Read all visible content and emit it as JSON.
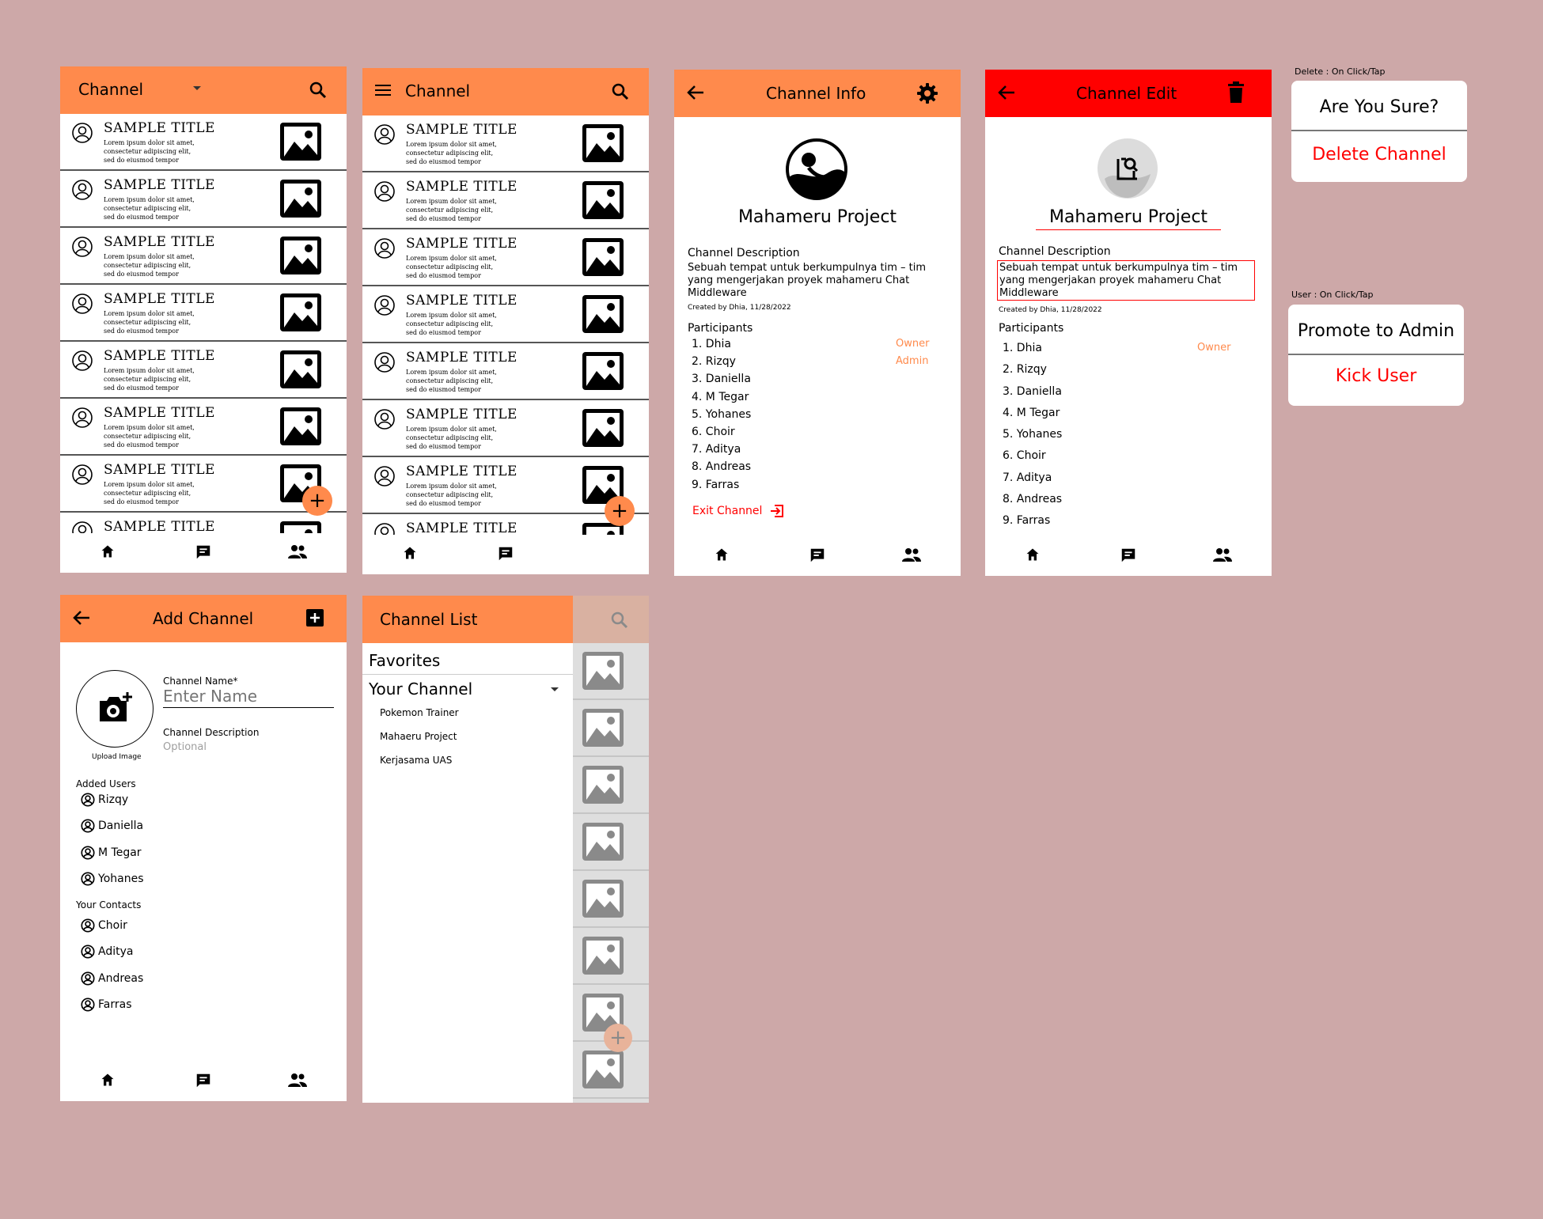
{
  "colors": {
    "accent": "#ff8a4c",
    "danger": "#ff0000",
    "background": "#cda8a8"
  },
  "screen1": {
    "title": "Channel",
    "rows": [
      {
        "title": "SAMPLE TITLE",
        "desc": "Lorem ipsum dolor sit amet, consectetur adipiscing elit, sed do eiusmod tempor"
      },
      {
        "title": "SAMPLE TITLE",
        "desc": "Lorem ipsum dolor sit amet, consectetur adipiscing elit, sed do eiusmod tempor"
      },
      {
        "title": "SAMPLE TITLE",
        "desc": "Lorem ipsum dolor sit amet, consectetur adipiscing elit, sed do eiusmod tempor"
      },
      {
        "title": "SAMPLE TITLE",
        "desc": "Lorem ipsum dolor sit amet, consectetur adipiscing elit, sed do eiusmod tempor"
      },
      {
        "title": "SAMPLE TITLE",
        "desc": "Lorem ipsum dolor sit amet, consectetur adipiscing elit, sed do eiusmod tempor"
      },
      {
        "title": "SAMPLE TITLE",
        "desc": "Lorem ipsum dolor sit amet, consectetur adipiscing elit, sed do eiusmod tempor"
      },
      {
        "title": "SAMPLE TITLE",
        "desc": "Lorem ipsum dolor sit amet, consectetur adipiscing elit, sed do eiusmod tempor"
      },
      {
        "title": "SAMPLE TITLE",
        "desc": ""
      }
    ],
    "fab": "+"
  },
  "screen2": {
    "title": "Channel",
    "rows": [
      {
        "title": "SAMPLE TITLE",
        "desc": "Lorem ipsum dolor sit amet, consectetur adipiscing elit, sed do eiusmod tempor"
      },
      {
        "title": "SAMPLE TITLE",
        "desc": "Lorem ipsum dolor sit amet, consectetur adipiscing elit, sed do eiusmod tempor"
      },
      {
        "title": "SAMPLE TITLE",
        "desc": "Lorem ipsum dolor sit amet, consectetur adipiscing elit, sed do eiusmod tempor"
      },
      {
        "title": "SAMPLE TITLE",
        "desc": "Lorem ipsum dolor sit amet, consectetur adipiscing elit, sed do eiusmod tempor"
      },
      {
        "title": "SAMPLE TITLE",
        "desc": "Lorem ipsum dolor sit amet, consectetur adipiscing elit, sed do eiusmod tempor"
      },
      {
        "title": "SAMPLE TITLE",
        "desc": "Lorem ipsum dolor sit amet, consectetur adipiscing elit, sed do eiusmod tempor"
      },
      {
        "title": "SAMPLE TITLE",
        "desc": "Lorem ipsum dolor sit amet, consectetur adipiscing elit, sed do eiusmod tempor"
      },
      {
        "title": "SAMPLE TITLE",
        "desc": ""
      }
    ],
    "fab": "+"
  },
  "info": {
    "title": "Channel Info",
    "name": "Mahameru Project",
    "desc_label": "Channel Description",
    "desc": "Sebuah tempat untuk berkumpulnya tim – tim yang mengerjakan proyek mahameru Chat Middleware",
    "created": "Created by Dhia, 11/28/2022",
    "participants_label": "Participants",
    "participants": [
      {
        "name": "1. Dhia",
        "role": "Owner"
      },
      {
        "name": "2. Rizqy",
        "role": "Admin"
      },
      {
        "name": "3. Daniella",
        "role": ""
      },
      {
        "name": "4. M Tegar",
        "role": ""
      },
      {
        "name": "5. Yohanes",
        "role": ""
      },
      {
        "name": "6. Choir",
        "role": ""
      },
      {
        "name": "7. Aditya",
        "role": ""
      },
      {
        "name": "8. Andreas",
        "role": ""
      },
      {
        "name": "9. Farras",
        "role": ""
      }
    ],
    "exit": "Exit Channel"
  },
  "edit": {
    "title": "Channel Edit",
    "name": "Mahameru Project",
    "desc_label": "Channel Description",
    "desc": "Sebuah tempat untuk berkumpulnya tim – tim yang mengerjakan proyek mahameru Chat Middleware",
    "created": "Created by Dhia, 11/28/2022",
    "participants_label": "Participants",
    "participants": [
      {
        "name": "1. Dhia",
        "role": "Owner"
      },
      {
        "name": "2. Rizqy",
        "role": ""
      },
      {
        "name": "3. Daniella",
        "role": ""
      },
      {
        "name": "4. M Tegar",
        "role": ""
      },
      {
        "name": "5. Yohanes",
        "role": ""
      },
      {
        "name": "6. Choir",
        "role": ""
      },
      {
        "name": "7. Aditya",
        "role": ""
      },
      {
        "name": "8. Andreas",
        "role": ""
      },
      {
        "name": "9. Farras",
        "role": ""
      }
    ]
  },
  "dialog_delete": {
    "caption": "Delete : On Click/Tap",
    "confirm": "Are You Sure?",
    "action": "Delete Channel"
  },
  "dialog_user": {
    "caption": "User : On Click/Tap",
    "promote": "Promote to Admin",
    "kick": "Kick User"
  },
  "add": {
    "title": "Add Channel",
    "name_label": "Channel Name*",
    "name_placeholder": "Enter Name",
    "desc_label": "Channel Description",
    "desc_placeholder": "Optional",
    "upload": "Upload Image",
    "added_label": "Added Users",
    "added": [
      "Rizqy",
      "Daniella",
      "M Tegar",
      "Yohanes"
    ],
    "contacts_label": "Your Contacts",
    "contacts": [
      "Choir",
      "Aditya",
      "Andreas",
      "Farras"
    ]
  },
  "drawer": {
    "title": "Channel List",
    "favorites": "Favorites",
    "your_channel": "Your Channel",
    "channels": [
      "Pokemon Trainer",
      "Mahaeru Project",
      "Kerjasama UAS"
    ],
    "fab": "+"
  }
}
